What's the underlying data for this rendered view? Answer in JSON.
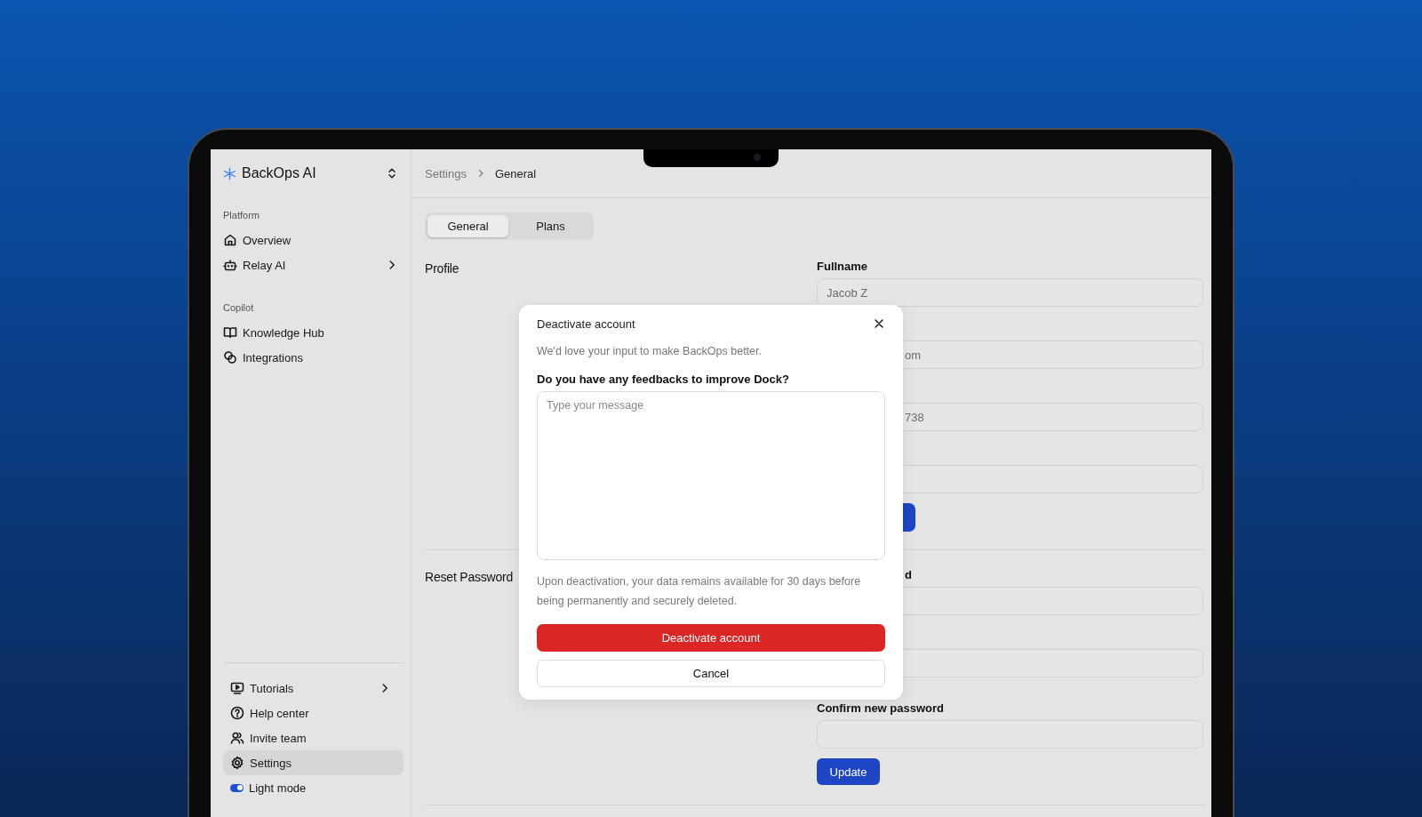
{
  "app": {
    "name": "BackOps AI"
  },
  "sidebar": {
    "sections": [
      {
        "heading": "Platform",
        "items": [
          {
            "label": "Overview",
            "submenu": false,
            "selected": false
          },
          {
            "label": "Relay AI",
            "submenu": true,
            "selected": false
          }
        ]
      },
      {
        "heading": "Copilot",
        "items": [
          {
            "label": "Knowledge Hub",
            "submenu": false,
            "selected": false
          },
          {
            "label": "Integrations",
            "submenu": false,
            "selected": false
          }
        ]
      }
    ],
    "footer_items": [
      {
        "kind": "link",
        "label": "Tutorials",
        "submenu": true,
        "selected": false
      },
      {
        "kind": "link",
        "label": "Help center",
        "submenu": false,
        "selected": false
      },
      {
        "kind": "link",
        "label": "Invite team",
        "submenu": false,
        "selected": false
      },
      {
        "kind": "link",
        "label": "Settings",
        "submenu": false,
        "selected": true
      },
      {
        "kind": "toggle",
        "label": "Light mode",
        "on": true
      }
    ]
  },
  "breadcrumb": [
    "Settings",
    "General"
  ],
  "tabs": [
    {
      "label": "General",
      "selected": true
    },
    {
      "label": "Plans",
      "selected": false
    }
  ],
  "profile": {
    "title": "Profile",
    "fields": [
      {
        "kind": "input",
        "label": "Fullname",
        "value": "Jacob Z"
      },
      {
        "kind": "input",
        "value": "om"
      },
      {
        "kind": "input",
        "value": "738"
      },
      {
        "kind": "input"
      }
    ]
  },
  "reset_password": {
    "title": "Reset Password",
    "fields": [
      {
        "kind": "input",
        "label": "d"
      },
      {
        "kind": "input"
      },
      {
        "kind": "input",
        "label": "Confirm new password"
      }
    ],
    "button": "Update"
  },
  "modal": {
    "title": "Deactivate account",
    "subtitle": "We'd love your input to make BackOps better.",
    "question": "Do you have any feedbacks to improve Dock?",
    "placeholder": "Type your message",
    "note": "Upon deactivation, your data remains available for 30 days before being permanently and securely deleted.",
    "confirm_button": "Deactivate account",
    "cancel_button": "Cancel"
  }
}
